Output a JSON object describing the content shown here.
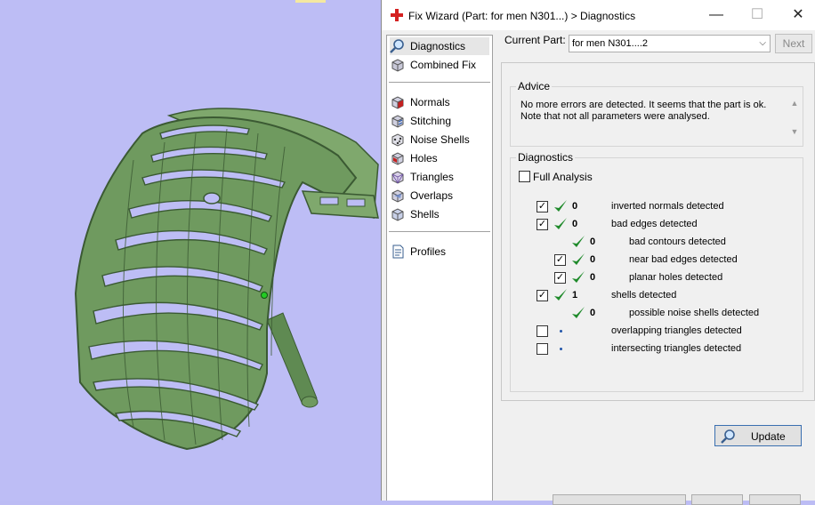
{
  "window": {
    "title": "Fix Wizard (Part: for men N301...) > Diagnostics",
    "minimize_glyph": "—",
    "maximize_glyph": "☐",
    "close_glyph": "✕"
  },
  "nav": {
    "items": [
      {
        "label": "Diagnostics",
        "icon": "magnifier-icon",
        "selected": true
      },
      {
        "label": "Combined Fix",
        "icon": "combined-fix-icon"
      },
      {
        "label": "Normals",
        "icon": "normals-cube-icon"
      },
      {
        "label": "Stitching",
        "icon": "stitching-cube-icon"
      },
      {
        "label": "Noise Shells",
        "icon": "noise-shells-icon"
      },
      {
        "label": "Holes",
        "icon": "holes-cube-icon"
      },
      {
        "label": "Triangles",
        "icon": "triangles-cube-icon"
      },
      {
        "label": "Overlaps",
        "icon": "overlaps-cube-icon"
      },
      {
        "label": "Shells",
        "icon": "shells-cube-icon"
      },
      {
        "label": "Profiles",
        "icon": "document-icon"
      }
    ]
  },
  "current_part": {
    "label": "Current Part:",
    "value": "for men N301....2",
    "next_label": "Next"
  },
  "advice": {
    "title": "Advice",
    "text": "No more errors are detected. It seems that the part is ok. Note that not all parameters were analysed."
  },
  "diagnostics": {
    "title": "Diagnostics",
    "full_analysis_label": "Full Analysis",
    "full_analysis_checked": false,
    "rows": [
      {
        "checkbox": true,
        "checked": true,
        "status": "ok",
        "count": "0",
        "label": "inverted normals detected",
        "indent": 0
      },
      {
        "checkbox": true,
        "checked": true,
        "status": "ok",
        "count": "0",
        "label": "bad edges detected",
        "indent": 0
      },
      {
        "checkbox": false,
        "checked": false,
        "status": "ok",
        "count": "0",
        "label": "bad contours detected",
        "indent": 1
      },
      {
        "checkbox": true,
        "checked": true,
        "status": "ok",
        "count": "0",
        "label": "near bad edges detected",
        "indent": 1
      },
      {
        "checkbox": true,
        "checked": true,
        "status": "ok",
        "count": "0",
        "label": "planar holes detected",
        "indent": 1
      },
      {
        "checkbox": true,
        "checked": true,
        "status": "ok",
        "count": "1",
        "label": "shells detected",
        "indent": 0
      },
      {
        "checkbox": false,
        "checked": false,
        "status": "ok",
        "count": "0",
        "label": "possible noise shells detected",
        "indent": 1
      },
      {
        "checkbox": true,
        "checked": false,
        "status": "pending",
        "count": "",
        "label": "overlapping triangles detected",
        "indent": 0
      },
      {
        "checkbox": true,
        "checked": false,
        "status": "pending",
        "count": "",
        "label": "intersecting triangles detected",
        "indent": 0
      }
    ],
    "update_label": "Update"
  },
  "colors": {
    "viewport_bg": "#bdbdf5",
    "model_green": "#6f9a5f",
    "check_green": "#1e8a2a",
    "title_icon_red": "#d42020"
  }
}
